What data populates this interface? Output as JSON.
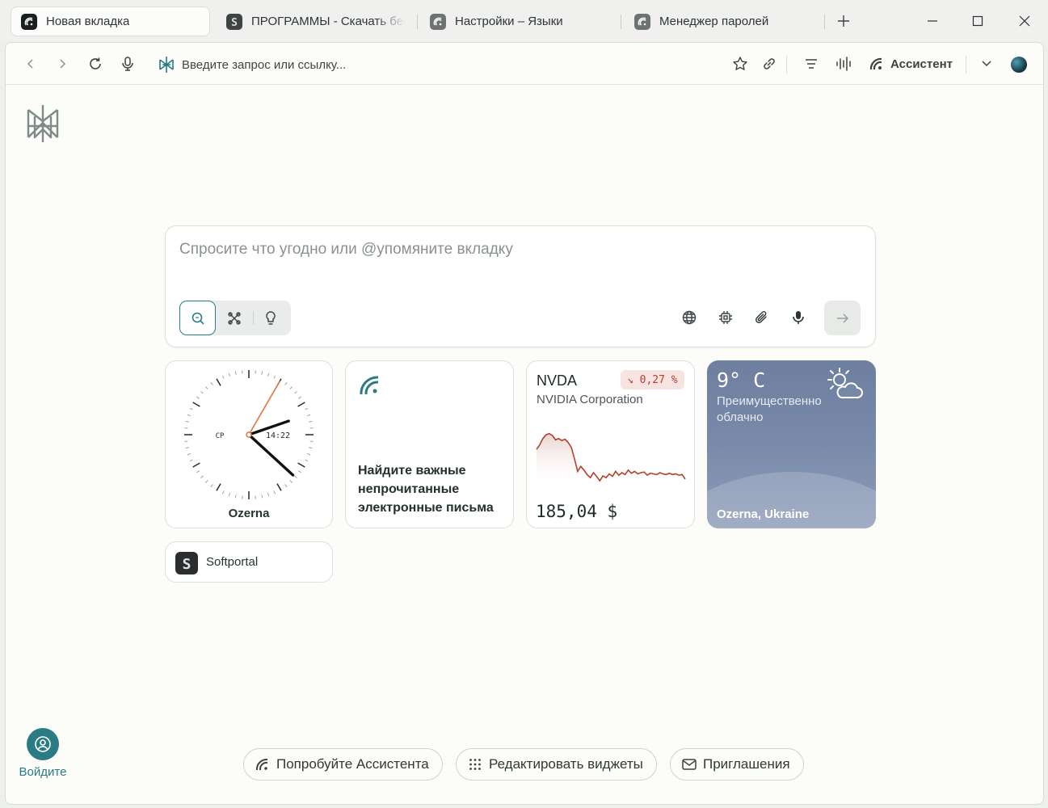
{
  "tabs": [
    {
      "label": "Новая вкладка",
      "favicon": "assistant-logo-icon",
      "active": true
    },
    {
      "label": "ПРОГРАММЫ - Скачать бес",
      "favicon": "softportal-icon",
      "active": false
    },
    {
      "label": "Настройки – Языки",
      "favicon": "assistant-logo-icon",
      "active": false
    },
    {
      "label": "Менеджер паролей",
      "favicon": "assistant-logo-icon",
      "active": false
    }
  ],
  "address": {
    "placeholder": "Введите запрос или ссылку..."
  },
  "toolbar": {
    "assistant_label": "Ассистент"
  },
  "search": {
    "placeholder": "Спросите что угодно или @упомяните вкладку"
  },
  "clock": {
    "day": "СР",
    "time": "14:22",
    "city": "Ozerna",
    "hour": 14,
    "minute": 22,
    "second": 5
  },
  "mail_widget": {
    "text": "Найдите важные непрочитанные электронные письма"
  },
  "stock": {
    "symbol": "NVDA",
    "company": "NVIDIA Corporation",
    "change": "↘ 0,27 %",
    "price": "185,04 $",
    "trend_color": "#b4402e",
    "series": [
      0.55,
      0.62,
      0.72,
      0.78,
      0.8,
      0.77,
      0.7,
      0.72,
      0.69,
      0.71,
      0.66,
      0.58,
      0.4,
      0.2,
      0.28,
      0.22,
      0.15,
      0.1,
      0.18,
      0.12,
      0.05,
      0.13,
      0.1,
      0.16,
      0.12,
      0.2,
      0.14,
      0.18,
      0.15,
      0.22,
      0.17,
      0.2,
      0.16,
      0.18,
      0.19,
      0.14,
      0.17,
      0.16,
      0.15,
      0.18,
      0.16,
      0.15,
      0.17,
      0.15,
      0.16,
      0.14,
      0.15,
      0.08
    ]
  },
  "weather": {
    "temp": "9° C",
    "desc": "Преимущественно облачно",
    "city": "Ozerna, Ukraine"
  },
  "shortcuts": [
    {
      "label": "Softportal"
    }
  ],
  "login": {
    "label": "Войдите"
  },
  "bottom": {
    "try_assistant": "Попробуйте Ассистента",
    "edit_widgets": "Редактировать виджеты",
    "invites": "Приглашения"
  },
  "colors": {
    "accent": "#2a7b84",
    "negative": "#b4402e"
  }
}
